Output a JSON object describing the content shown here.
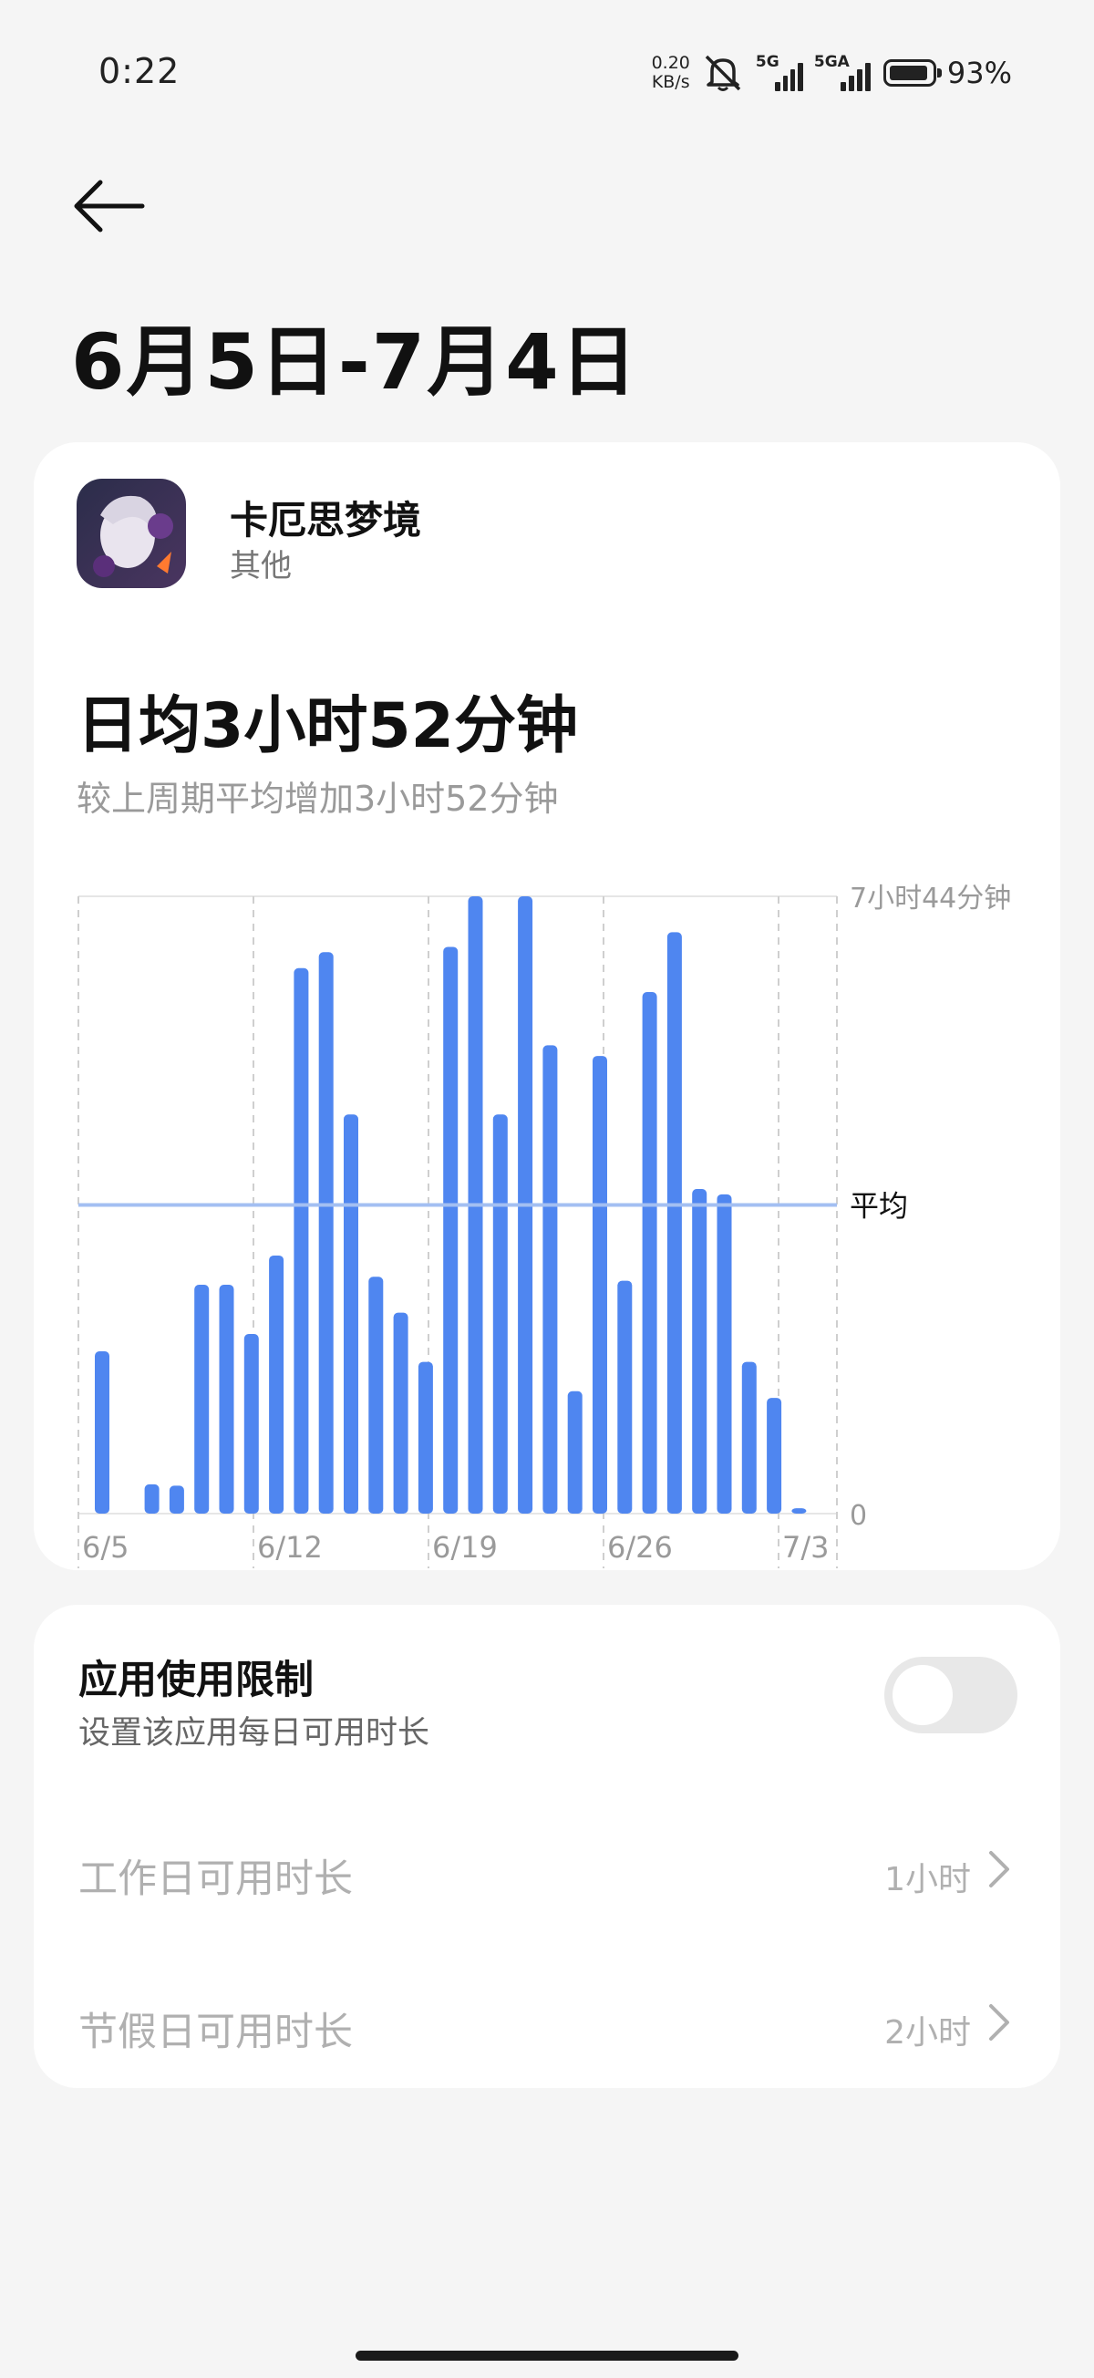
{
  "status": {
    "time": "0:22",
    "net_speed_value": "0.20",
    "net_speed_unit": "KB/s",
    "signal_1_label": "5G",
    "signal_2_label": "5GA",
    "battery_percent": "93%",
    "battery_level": 0.93
  },
  "header": {
    "title": "6月5日-7月4日"
  },
  "app": {
    "name": "卡厄思梦境",
    "category": "其他"
  },
  "summary": {
    "daily_average": "日均3小时52分钟",
    "comparison": "较上周期平均增加3小时52分钟"
  },
  "chart_data": {
    "type": "bar",
    "categories": [
      "6/5",
      "6/6",
      "6/7",
      "6/8",
      "6/9",
      "6/10",
      "6/11",
      "6/12",
      "6/13",
      "6/14",
      "6/15",
      "6/16",
      "6/17",
      "6/18",
      "6/19",
      "6/20",
      "6/21",
      "6/22",
      "6/23",
      "6/24",
      "6/25",
      "6/26",
      "6/27",
      "6/28",
      "6/29",
      "6/30",
      "7/1",
      "7/2",
      "7/3",
      "7/4"
    ],
    "x_tick_labels": [
      "6/5",
      "6/12",
      "6/19",
      "6/26",
      "7/3"
    ],
    "values": [
      122,
      0,
      22,
      21,
      172,
      172,
      135,
      194,
      410,
      422,
      300,
      178,
      151,
      114,
      426,
      464,
      300,
      464,
      352,
      92,
      344,
      175,
      392,
      437,
      244,
      240,
      114,
      87,
      4,
      0
    ],
    "unit": "minutes",
    "ylim": [
      0,
      464
    ],
    "y_max_label": "7小时44分钟",
    "y_min_label": "0",
    "average_value": 232,
    "average_label": "平均",
    "color": "#4f86f0",
    "average_line_color": "#a3bff2",
    "grid": "vertical dashed"
  },
  "limits": {
    "title": "应用使用限制",
    "subtitle": "设置该应用每日可用时长",
    "enabled": false,
    "workday_label": "工作日可用时长",
    "workday_value": "1小时",
    "holiday_label": "节假日可用时长",
    "holiday_value": "2小时"
  }
}
